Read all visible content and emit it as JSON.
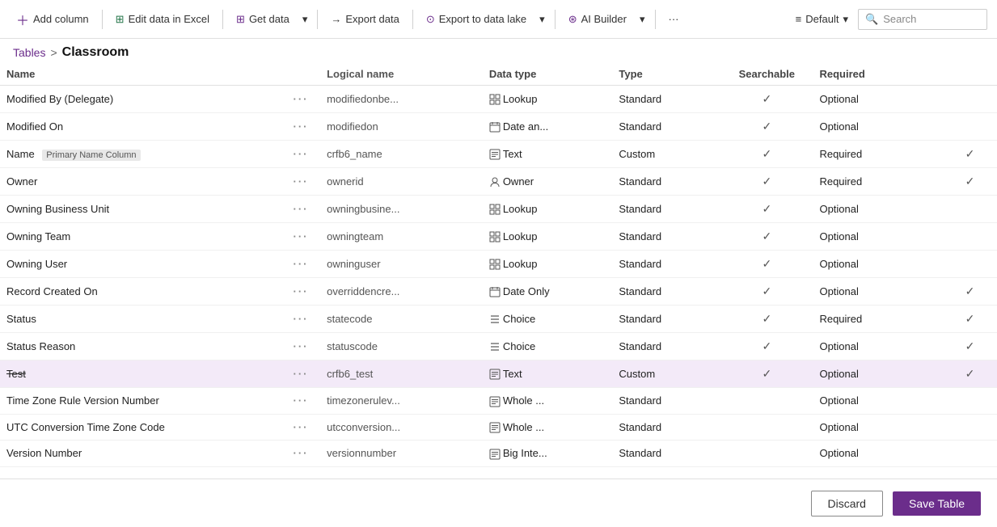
{
  "toolbar": {
    "add_column": "Add column",
    "edit_excel": "Edit data in Excel",
    "get_data": "Get data",
    "export_data": "Export data",
    "export_lake": "Export to data lake",
    "ai_builder": "AI Builder",
    "more": "···",
    "default": "Default",
    "search": "Search"
  },
  "breadcrumb": {
    "parent": "Tables",
    "separator": ">",
    "current": "Classroom"
  },
  "columns": {
    "headers": [
      "Name",
      "",
      "Logical name",
      "Data type",
      "Type",
      "Searchable",
      "Required",
      ""
    ]
  },
  "rows": [
    {
      "name": "Modified By (Delegate)",
      "dots": "···",
      "logical": "modifiedonbe...",
      "type_icon": "lookup",
      "type_label": "Lookup",
      "custom": "Standard",
      "searchable": true,
      "required": "Optional",
      "req_check": false,
      "selected": false,
      "strikethrough": false,
      "primary": false
    },
    {
      "name": "Modified On",
      "dots": "···",
      "logical": "modifiedon",
      "type_icon": "date",
      "type_label": "Date an...",
      "custom": "Standard",
      "searchable": true,
      "required": "Optional",
      "req_check": false,
      "selected": false,
      "strikethrough": false,
      "primary": false
    },
    {
      "name": "Name",
      "dots": "···",
      "logical": "crfb6_name",
      "type_icon": "text",
      "type_label": "Text",
      "custom": "Custom",
      "searchable": true,
      "required": "Required",
      "req_check": true,
      "selected": false,
      "strikethrough": false,
      "primary": true
    },
    {
      "name": "Owner",
      "dots": "···",
      "logical": "ownerid",
      "type_icon": "owner",
      "type_label": "Owner",
      "custom": "Standard",
      "searchable": true,
      "required": "Required",
      "req_check": true,
      "selected": false,
      "strikethrough": false,
      "primary": false
    },
    {
      "name": "Owning Business Unit",
      "dots": "···",
      "logical": "owningbusine...",
      "type_icon": "lookup",
      "type_label": "Lookup",
      "custom": "Standard",
      "searchable": true,
      "required": "Optional",
      "req_check": false,
      "selected": false,
      "strikethrough": false,
      "primary": false
    },
    {
      "name": "Owning Team",
      "dots": "···",
      "logical": "owningteam",
      "type_icon": "lookup",
      "type_label": "Lookup",
      "custom": "Standard",
      "searchable": true,
      "required": "Optional",
      "req_check": false,
      "selected": false,
      "strikethrough": false,
      "primary": false
    },
    {
      "name": "Owning User",
      "dots": "···",
      "logical": "owninguser",
      "type_icon": "lookup",
      "type_label": "Lookup",
      "custom": "Standard",
      "searchable": true,
      "required": "Optional",
      "req_check": false,
      "selected": false,
      "strikethrough": false,
      "primary": false
    },
    {
      "name": "Record Created On",
      "dots": "···",
      "logical": "overriddencre...",
      "type_icon": "date",
      "type_label": "Date Only",
      "custom": "Standard",
      "searchable": true,
      "required": "Optional",
      "req_check": true,
      "selected": false,
      "strikethrough": false,
      "primary": false
    },
    {
      "name": "Status",
      "dots": "···",
      "logical": "statecode",
      "type_icon": "choice",
      "type_label": "Choice",
      "custom": "Standard",
      "searchable": true,
      "required": "Required",
      "req_check": true,
      "selected": false,
      "strikethrough": false,
      "primary": false
    },
    {
      "name": "Status Reason",
      "dots": "···",
      "logical": "statuscode",
      "type_icon": "choice",
      "type_label": "Choice",
      "custom": "Standard",
      "searchable": true,
      "required": "Optional",
      "req_check": true,
      "selected": false,
      "strikethrough": false,
      "primary": false
    },
    {
      "name": "Test",
      "dots": "···",
      "logical": "crfb6_test",
      "type_icon": "text",
      "type_label": "Text",
      "custom": "Custom",
      "searchable": true,
      "required": "Optional",
      "req_check": true,
      "selected": true,
      "strikethrough": true,
      "primary": false
    },
    {
      "name": "Time Zone Rule Version Number",
      "dots": "···",
      "logical": "timezonerulev...",
      "type_icon": "whole",
      "type_label": "Whole ...",
      "custom": "Standard",
      "searchable": false,
      "required": "Optional",
      "req_check": false,
      "selected": false,
      "strikethrough": false,
      "primary": false
    },
    {
      "name": "UTC Conversion Time Zone Code",
      "dots": "···",
      "logical": "utcconversion...",
      "type_icon": "whole",
      "type_label": "Whole ...",
      "custom": "Standard",
      "searchable": false,
      "required": "Optional",
      "req_check": false,
      "selected": false,
      "strikethrough": false,
      "primary": false
    },
    {
      "name": "Version Number",
      "dots": "···",
      "logical": "versionnumber",
      "type_icon": "bigint",
      "type_label": "Big Inte...",
      "custom": "Standard",
      "searchable": false,
      "required": "Optional",
      "req_check": false,
      "selected": false,
      "strikethrough": false,
      "primary": false
    }
  ],
  "footer": {
    "discard": "Discard",
    "save": "Save Table"
  },
  "type_icons": {
    "lookup": "⊞",
    "date": "📅",
    "text": "⊟",
    "owner": "👤",
    "choice": "☰",
    "whole": "⊟",
    "bigint": "⊟"
  }
}
